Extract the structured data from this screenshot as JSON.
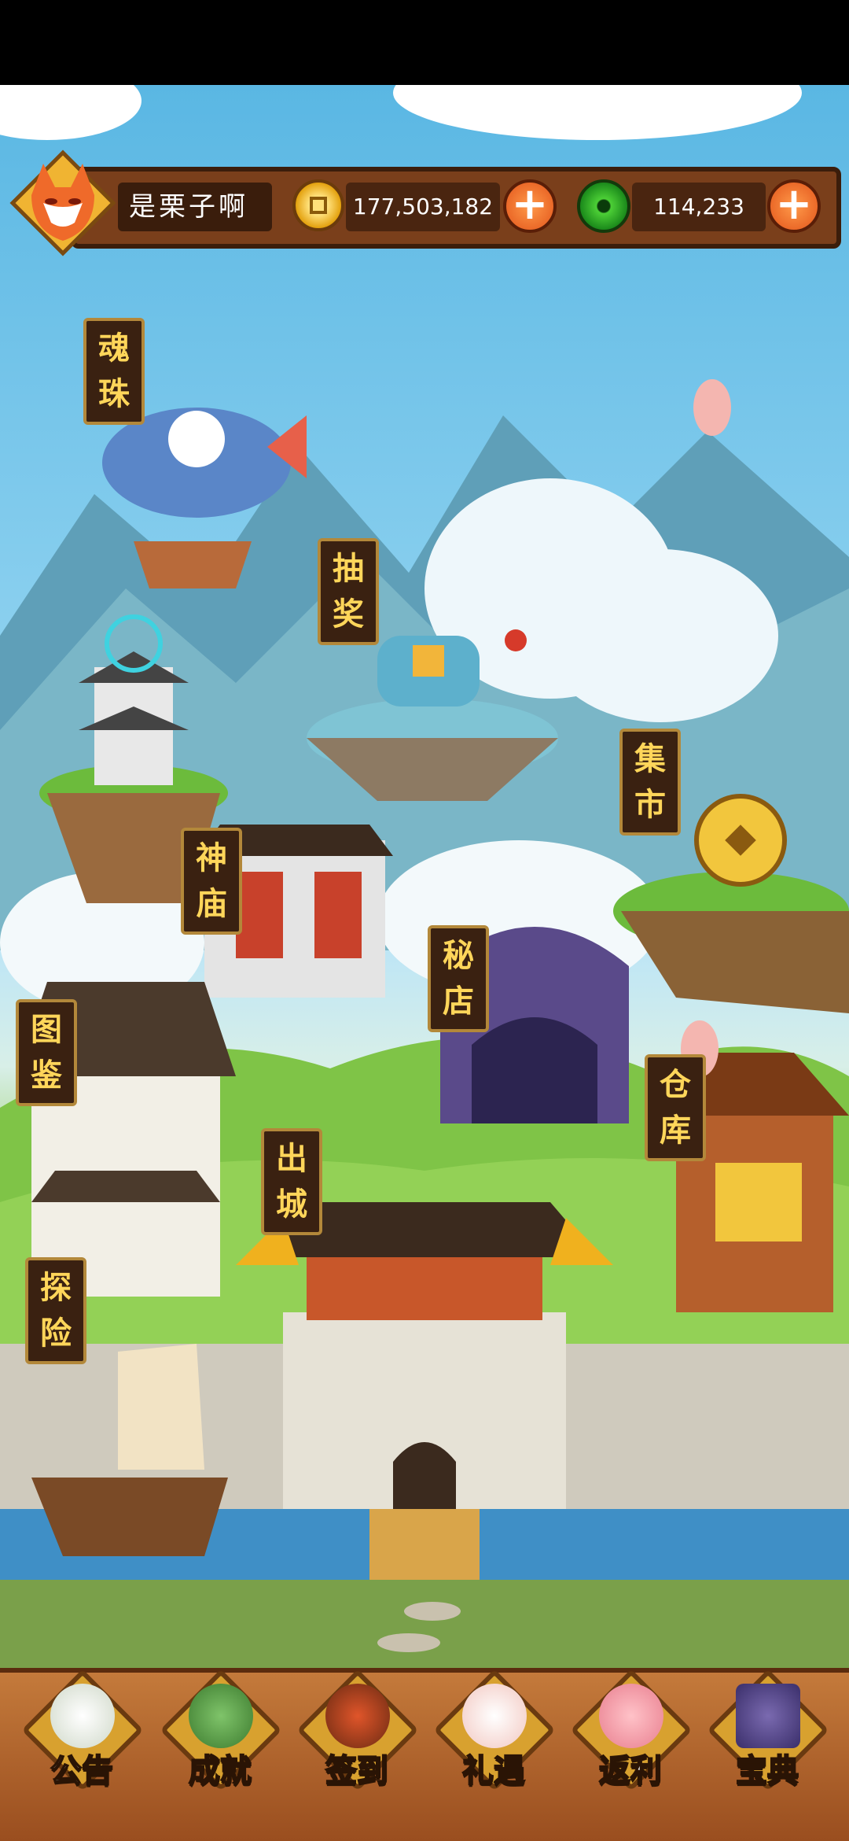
{
  "player": {
    "name": "是栗子啊"
  },
  "resources": {
    "coins": "177,503,182",
    "jade": "114,233"
  },
  "buildings": {
    "hunzhu": [
      "魂",
      "珠"
    ],
    "choujiang": [
      "抽",
      "奖"
    ],
    "jishi": [
      "集",
      "市"
    ],
    "shenmiao": [
      "神",
      "庙"
    ],
    "midian": [
      "秘",
      "店"
    ],
    "tujian": [
      "图",
      "鉴"
    ],
    "cangku": [
      "仓",
      "库"
    ],
    "chucheng": [
      "出",
      "城"
    ],
    "tanxian": [
      "探",
      "险"
    ]
  },
  "menu": [
    {
      "label": "公告",
      "icon": "scroll-icon"
    },
    {
      "label": "成就",
      "icon": "dragon-statue-icon"
    },
    {
      "label": "签到",
      "icon": "gate-icon"
    },
    {
      "label": "礼遇",
      "icon": "lucky-cat-icon"
    },
    {
      "label": "返利",
      "icon": "piggy-bank-icon"
    },
    {
      "label": "宝典",
      "icon": "book-icon"
    }
  ]
}
